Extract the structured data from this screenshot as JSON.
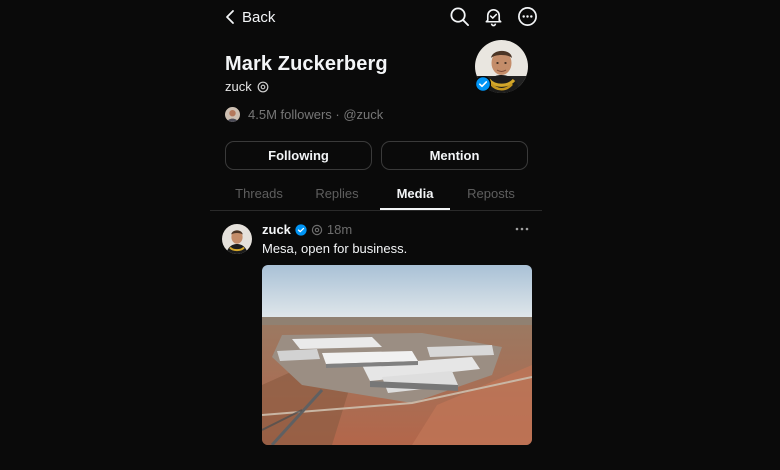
{
  "nav": {
    "back_label": "Back"
  },
  "profile": {
    "name": "Mark Zuckerberg",
    "handle": "zuck",
    "followers_text": "4.5M followers · @zuck"
  },
  "actions": {
    "following_label": "Following",
    "mention_label": "Mention"
  },
  "tabs": [
    {
      "label": "Threads",
      "active": false
    },
    {
      "label": "Replies",
      "active": false
    },
    {
      "label": "Media",
      "active": true
    },
    {
      "label": "Reposts",
      "active": false
    }
  ],
  "post": {
    "username": "zuck",
    "time": "18m",
    "text": "Mesa, open for business."
  },
  "colors": {
    "background": "#0a0a0a",
    "text": "#f3f5f7",
    "muted": "#777777",
    "verified": "#0095f6",
    "border": "#3a3a3a"
  },
  "icons": [
    "back-chevron-icon",
    "search-icon",
    "notification-bell-icon",
    "more-options-icon",
    "threads-logo-icon",
    "verified-badge-icon",
    "more-horizontal-icon"
  ]
}
